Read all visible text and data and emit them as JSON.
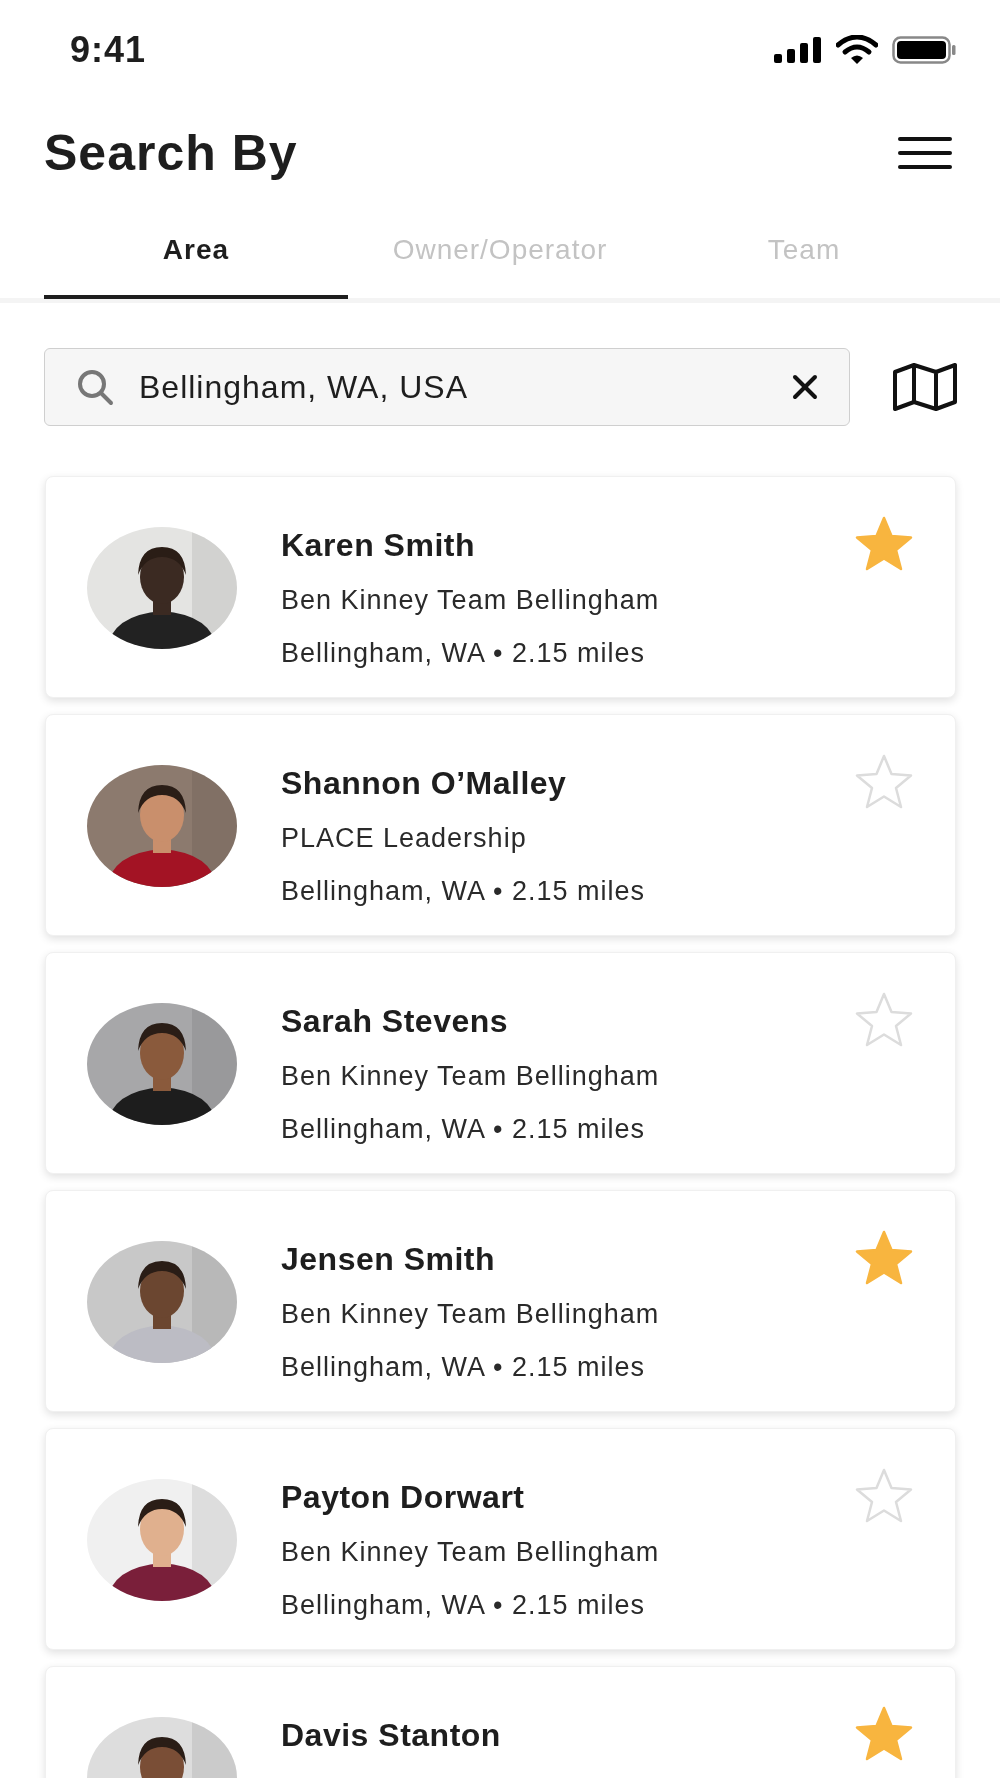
{
  "status_bar": {
    "time": "9:41"
  },
  "header": {
    "title": "Search By"
  },
  "tabs": [
    {
      "label": "Area",
      "selected": true
    },
    {
      "label": "Owner/Operator",
      "selected": false
    },
    {
      "label": "Team",
      "selected": false
    }
  ],
  "search": {
    "value": "Bellingham, WA, USA"
  },
  "results": [
    {
      "name": "Karen Smith",
      "team": "Ben Kinney Team Bellingham",
      "location": "Bellingham, WA • 2.15 miles",
      "favorite": true
    },
    {
      "name": "Shannon O’Malley",
      "team": "PLACE Leadership",
      "location": "Bellingham, WA • 2.15 miles",
      "favorite": false
    },
    {
      "name": "Sarah Stevens",
      "team": "Ben Kinney Team Bellingham",
      "location": "Bellingham, WA • 2.15 miles",
      "favorite": false
    },
    {
      "name": "Jensen Smith",
      "team": "Ben Kinney Team Bellingham",
      "location": "Bellingham, WA • 2.15 miles",
      "favorite": true
    },
    {
      "name": "Payton Dorwart",
      "team": "Ben Kinney Team Bellingham",
      "location": "Bellingham, WA • 2.15 miles",
      "favorite": false
    },
    {
      "name": "Davis Stanton",
      "favorite": true
    }
  ]
}
